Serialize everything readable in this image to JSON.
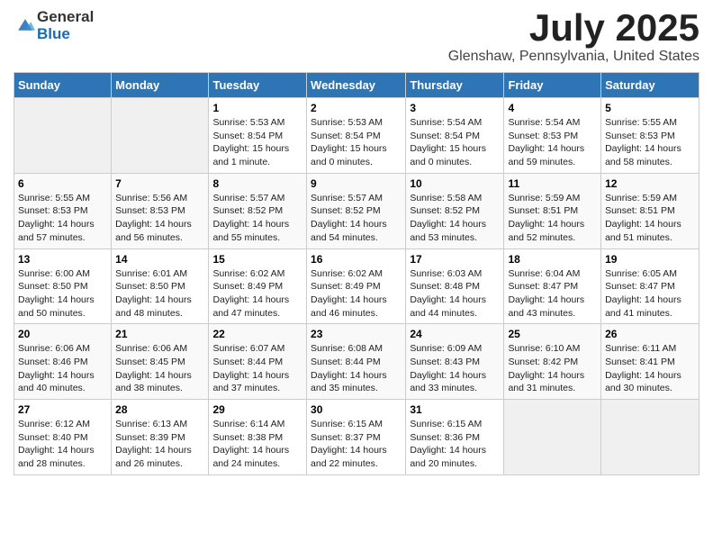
{
  "header": {
    "logo_general": "General",
    "logo_blue": "Blue",
    "title": "July 2025",
    "subtitle": "Glenshaw, Pennsylvania, United States"
  },
  "weekdays": [
    "Sunday",
    "Monday",
    "Tuesday",
    "Wednesday",
    "Thursday",
    "Friday",
    "Saturday"
  ],
  "weeks": [
    [
      {
        "day": "",
        "empty": true
      },
      {
        "day": "",
        "empty": true
      },
      {
        "day": "1",
        "sunrise": "5:53 AM",
        "sunset": "8:54 PM",
        "daylight": "15 hours and 1 minute."
      },
      {
        "day": "2",
        "sunrise": "5:53 AM",
        "sunset": "8:54 PM",
        "daylight": "15 hours and 0 minutes."
      },
      {
        "day": "3",
        "sunrise": "5:54 AM",
        "sunset": "8:54 PM",
        "daylight": "15 hours and 0 minutes."
      },
      {
        "day": "4",
        "sunrise": "5:54 AM",
        "sunset": "8:53 PM",
        "daylight": "14 hours and 59 minutes."
      },
      {
        "day": "5",
        "sunrise": "5:55 AM",
        "sunset": "8:53 PM",
        "daylight": "14 hours and 58 minutes."
      }
    ],
    [
      {
        "day": "6",
        "sunrise": "5:55 AM",
        "sunset": "8:53 PM",
        "daylight": "14 hours and 57 minutes."
      },
      {
        "day": "7",
        "sunrise": "5:56 AM",
        "sunset": "8:53 PM",
        "daylight": "14 hours and 56 minutes."
      },
      {
        "day": "8",
        "sunrise": "5:57 AM",
        "sunset": "8:52 PM",
        "daylight": "14 hours and 55 minutes."
      },
      {
        "day": "9",
        "sunrise": "5:57 AM",
        "sunset": "8:52 PM",
        "daylight": "14 hours and 54 minutes."
      },
      {
        "day": "10",
        "sunrise": "5:58 AM",
        "sunset": "8:52 PM",
        "daylight": "14 hours and 53 minutes."
      },
      {
        "day": "11",
        "sunrise": "5:59 AM",
        "sunset": "8:51 PM",
        "daylight": "14 hours and 52 minutes."
      },
      {
        "day": "12",
        "sunrise": "5:59 AM",
        "sunset": "8:51 PM",
        "daylight": "14 hours and 51 minutes."
      }
    ],
    [
      {
        "day": "13",
        "sunrise": "6:00 AM",
        "sunset": "8:50 PM",
        "daylight": "14 hours and 50 minutes."
      },
      {
        "day": "14",
        "sunrise": "6:01 AM",
        "sunset": "8:50 PM",
        "daylight": "14 hours and 48 minutes."
      },
      {
        "day": "15",
        "sunrise": "6:02 AM",
        "sunset": "8:49 PM",
        "daylight": "14 hours and 47 minutes."
      },
      {
        "day": "16",
        "sunrise": "6:02 AM",
        "sunset": "8:49 PM",
        "daylight": "14 hours and 46 minutes."
      },
      {
        "day": "17",
        "sunrise": "6:03 AM",
        "sunset": "8:48 PM",
        "daylight": "14 hours and 44 minutes."
      },
      {
        "day": "18",
        "sunrise": "6:04 AM",
        "sunset": "8:47 PM",
        "daylight": "14 hours and 43 minutes."
      },
      {
        "day": "19",
        "sunrise": "6:05 AM",
        "sunset": "8:47 PM",
        "daylight": "14 hours and 41 minutes."
      }
    ],
    [
      {
        "day": "20",
        "sunrise": "6:06 AM",
        "sunset": "8:46 PM",
        "daylight": "14 hours and 40 minutes."
      },
      {
        "day": "21",
        "sunrise": "6:06 AM",
        "sunset": "8:45 PM",
        "daylight": "14 hours and 38 minutes."
      },
      {
        "day": "22",
        "sunrise": "6:07 AM",
        "sunset": "8:44 PM",
        "daylight": "14 hours and 37 minutes."
      },
      {
        "day": "23",
        "sunrise": "6:08 AM",
        "sunset": "8:44 PM",
        "daylight": "14 hours and 35 minutes."
      },
      {
        "day": "24",
        "sunrise": "6:09 AM",
        "sunset": "8:43 PM",
        "daylight": "14 hours and 33 minutes."
      },
      {
        "day": "25",
        "sunrise": "6:10 AM",
        "sunset": "8:42 PM",
        "daylight": "14 hours and 31 minutes."
      },
      {
        "day": "26",
        "sunrise": "6:11 AM",
        "sunset": "8:41 PM",
        "daylight": "14 hours and 30 minutes."
      }
    ],
    [
      {
        "day": "27",
        "sunrise": "6:12 AM",
        "sunset": "8:40 PM",
        "daylight": "14 hours and 28 minutes."
      },
      {
        "day": "28",
        "sunrise": "6:13 AM",
        "sunset": "8:39 PM",
        "daylight": "14 hours and 26 minutes."
      },
      {
        "day": "29",
        "sunrise": "6:14 AM",
        "sunset": "8:38 PM",
        "daylight": "14 hours and 24 minutes."
      },
      {
        "day": "30",
        "sunrise": "6:15 AM",
        "sunset": "8:37 PM",
        "daylight": "14 hours and 22 minutes."
      },
      {
        "day": "31",
        "sunrise": "6:15 AM",
        "sunset": "8:36 PM",
        "daylight": "14 hours and 20 minutes."
      },
      {
        "day": "",
        "empty": true
      },
      {
        "day": "",
        "empty": true
      }
    ]
  ],
  "labels": {
    "sunrise_prefix": "Sunrise: ",
    "sunset_prefix": "Sunset: ",
    "daylight_prefix": "Daylight: "
  }
}
